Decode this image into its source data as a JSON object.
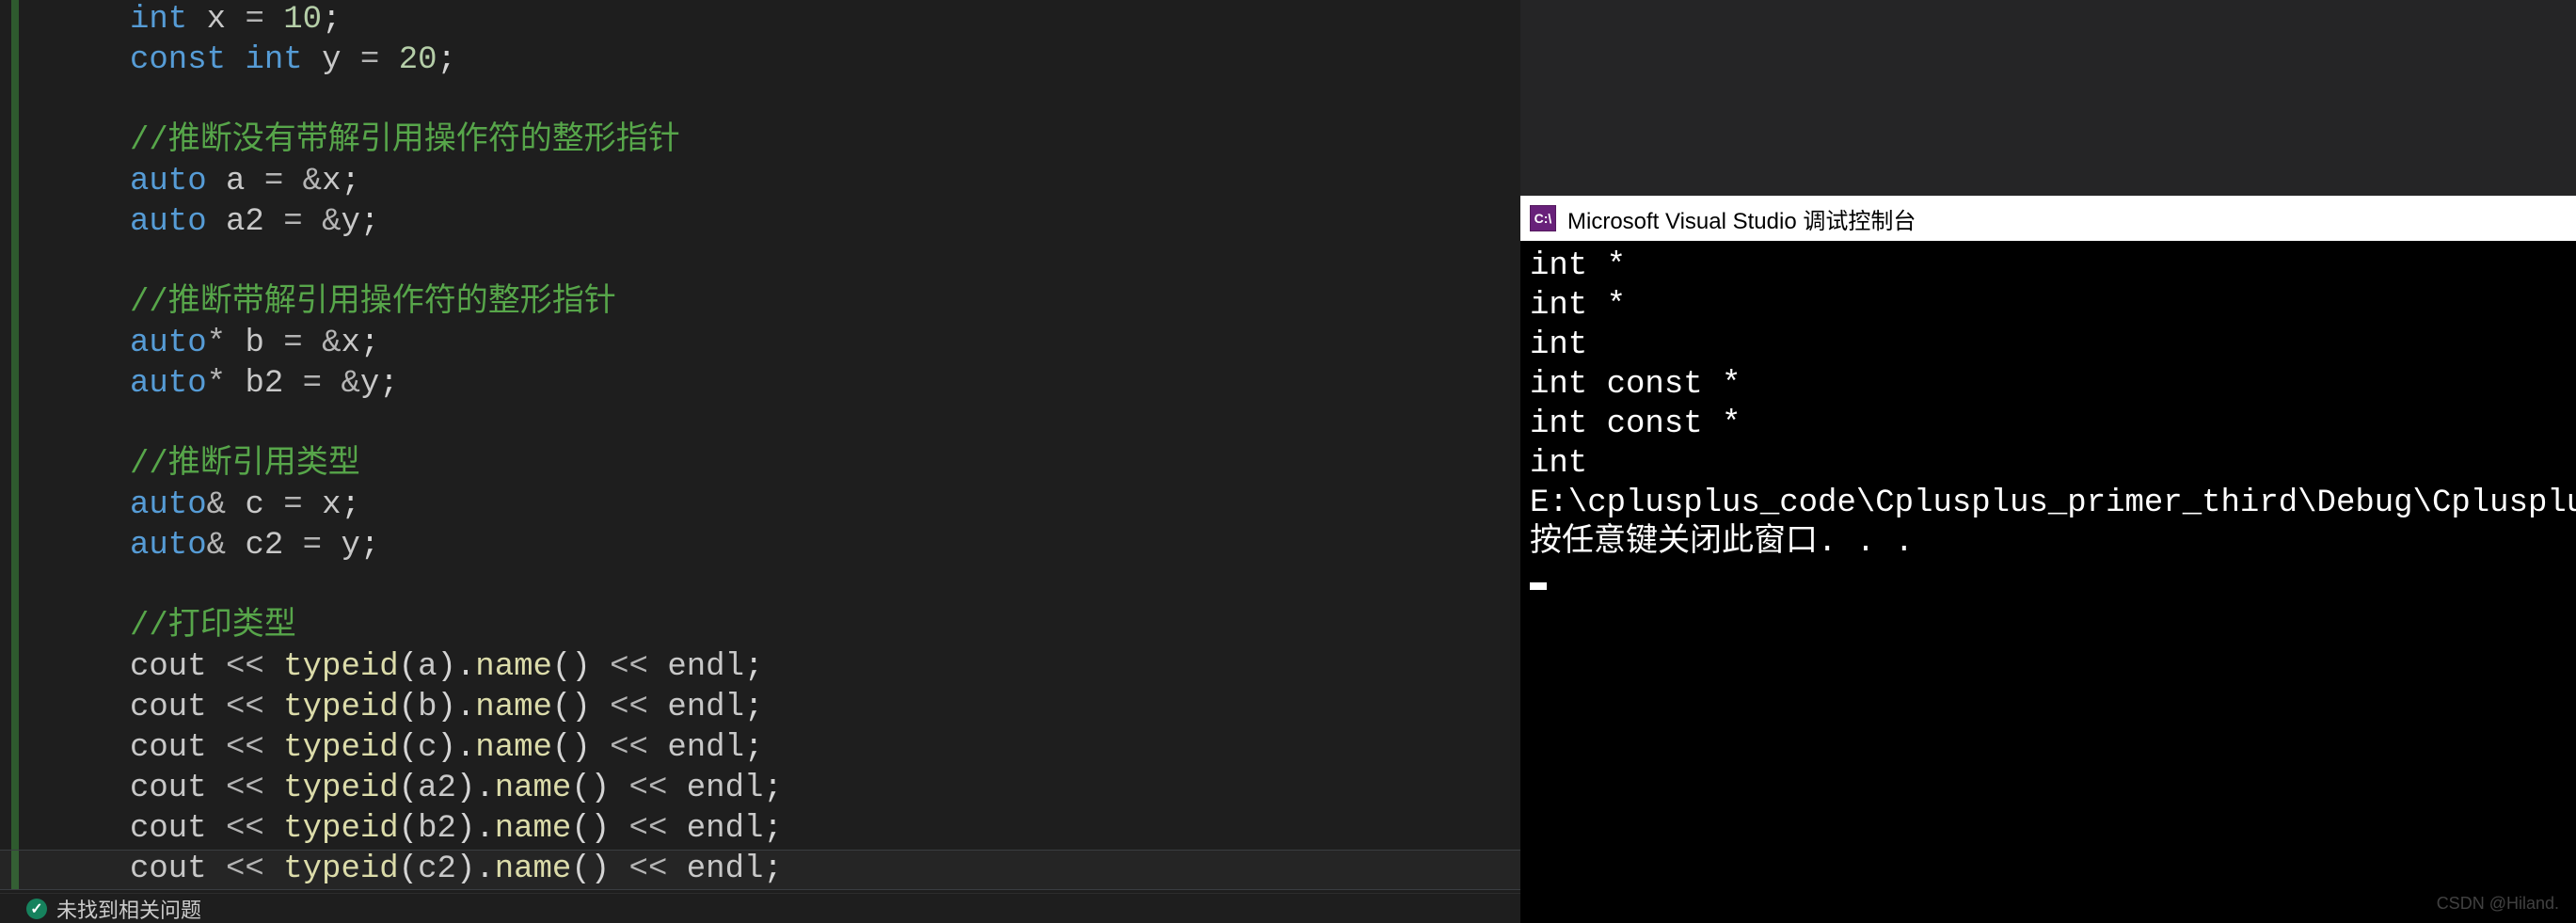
{
  "editor": {
    "lines": [
      {
        "indent": 1,
        "tokens": [
          [
            "kw",
            "int"
          ],
          [
            "punc",
            " "
          ],
          [
            "ident",
            "x"
          ],
          [
            "punc",
            " "
          ],
          [
            "op",
            "="
          ],
          [
            "punc",
            " "
          ],
          [
            "num",
            "10"
          ],
          [
            "punc",
            ";"
          ]
        ]
      },
      {
        "indent": 1,
        "tokens": [
          [
            "kw",
            "const"
          ],
          [
            "punc",
            " "
          ],
          [
            "kw",
            "int"
          ],
          [
            "punc",
            " "
          ],
          [
            "ident",
            "y"
          ],
          [
            "punc",
            " "
          ],
          [
            "op",
            "="
          ],
          [
            "punc",
            " "
          ],
          [
            "num",
            "20"
          ],
          [
            "punc",
            ";"
          ]
        ]
      },
      {
        "indent": 1,
        "tokens": []
      },
      {
        "indent": 1,
        "tokens": [
          [
            "cmt",
            "//推断没有带解引用操作符的整形指针"
          ]
        ]
      },
      {
        "indent": 1,
        "tokens": [
          [
            "kw",
            "auto"
          ],
          [
            "punc",
            " "
          ],
          [
            "ident",
            "a"
          ],
          [
            "punc",
            " "
          ],
          [
            "op",
            "="
          ],
          [
            "punc",
            " "
          ],
          [
            "op",
            "&"
          ],
          [
            "ident",
            "x"
          ],
          [
            "punc",
            ";"
          ]
        ]
      },
      {
        "indent": 1,
        "tokens": [
          [
            "kw",
            "auto"
          ],
          [
            "punc",
            " "
          ],
          [
            "ident",
            "a2"
          ],
          [
            "punc",
            " "
          ],
          [
            "op",
            "="
          ],
          [
            "punc",
            " "
          ],
          [
            "op",
            "&"
          ],
          [
            "ident",
            "y"
          ],
          [
            "punc",
            ";"
          ]
        ]
      },
      {
        "indent": 1,
        "tokens": []
      },
      {
        "indent": 1,
        "tokens": [
          [
            "cmt",
            "//推断带解引用操作符的整形指针"
          ]
        ]
      },
      {
        "indent": 1,
        "tokens": [
          [
            "kw",
            "auto"
          ],
          [
            "op",
            "*"
          ],
          [
            "punc",
            " "
          ],
          [
            "ident",
            "b"
          ],
          [
            "punc",
            " "
          ],
          [
            "op",
            "="
          ],
          [
            "punc",
            " "
          ],
          [
            "op",
            "&"
          ],
          [
            "ident",
            "x"
          ],
          [
            "punc",
            ";"
          ]
        ]
      },
      {
        "indent": 1,
        "tokens": [
          [
            "kw",
            "auto"
          ],
          [
            "op",
            "*"
          ],
          [
            "punc",
            " "
          ],
          [
            "ident",
            "b2"
          ],
          [
            "punc",
            " "
          ],
          [
            "op",
            "="
          ],
          [
            "punc",
            " "
          ],
          [
            "op",
            "&"
          ],
          [
            "ident",
            "y"
          ],
          [
            "punc",
            ";"
          ]
        ]
      },
      {
        "indent": 1,
        "tokens": []
      },
      {
        "indent": 1,
        "tokens": [
          [
            "cmt",
            "//推断引用类型"
          ]
        ]
      },
      {
        "indent": 1,
        "tokens": [
          [
            "kw",
            "auto"
          ],
          [
            "op",
            "&"
          ],
          [
            "punc",
            " "
          ],
          [
            "ident",
            "c"
          ],
          [
            "punc",
            " "
          ],
          [
            "op",
            "="
          ],
          [
            "punc",
            " "
          ],
          [
            "ident",
            "x"
          ],
          [
            "punc",
            ";"
          ]
        ]
      },
      {
        "indent": 1,
        "tokens": [
          [
            "kw",
            "auto"
          ],
          [
            "op",
            "&"
          ],
          [
            "punc",
            " "
          ],
          [
            "ident",
            "c2"
          ],
          [
            "punc",
            " "
          ],
          [
            "op",
            "="
          ],
          [
            "punc",
            " "
          ],
          [
            "ident",
            "y"
          ],
          [
            "punc",
            ";"
          ]
        ]
      },
      {
        "indent": 1,
        "tokens": []
      },
      {
        "indent": 1,
        "tokens": [
          [
            "cmt",
            "//打印类型"
          ]
        ]
      },
      {
        "indent": 1,
        "tokens": [
          [
            "ident",
            "cout"
          ],
          [
            "punc",
            " "
          ],
          [
            "op",
            "<<"
          ],
          [
            "punc",
            " "
          ],
          [
            "func",
            "typeid"
          ],
          [
            "punc",
            "("
          ],
          [
            "ident",
            "a"
          ],
          [
            "punc",
            ")."
          ],
          [
            "call",
            "name"
          ],
          [
            "punc",
            "()"
          ],
          [
            "punc",
            " "
          ],
          [
            "op",
            "<<"
          ],
          [
            "punc",
            " "
          ],
          [
            "ident",
            "endl"
          ],
          [
            "punc",
            ";"
          ]
        ]
      },
      {
        "indent": 1,
        "tokens": [
          [
            "ident",
            "cout"
          ],
          [
            "punc",
            " "
          ],
          [
            "op",
            "<<"
          ],
          [
            "punc",
            " "
          ],
          [
            "func",
            "typeid"
          ],
          [
            "punc",
            "("
          ],
          [
            "ident",
            "b"
          ],
          [
            "punc",
            ")."
          ],
          [
            "call",
            "name"
          ],
          [
            "punc",
            "()"
          ],
          [
            "punc",
            " "
          ],
          [
            "op",
            "<<"
          ],
          [
            "punc",
            " "
          ],
          [
            "ident",
            "endl"
          ],
          [
            "punc",
            ";"
          ]
        ]
      },
      {
        "indent": 1,
        "tokens": [
          [
            "ident",
            "cout"
          ],
          [
            "punc",
            " "
          ],
          [
            "op",
            "<<"
          ],
          [
            "punc",
            " "
          ],
          [
            "func",
            "typeid"
          ],
          [
            "punc",
            "("
          ],
          [
            "ident",
            "c"
          ],
          [
            "punc",
            ")."
          ],
          [
            "call",
            "name"
          ],
          [
            "punc",
            "()"
          ],
          [
            "punc",
            " "
          ],
          [
            "op",
            "<<"
          ],
          [
            "punc",
            " "
          ],
          [
            "ident",
            "endl"
          ],
          [
            "punc",
            ";"
          ]
        ]
      },
      {
        "indent": 1,
        "tokens": [
          [
            "ident",
            "cout"
          ],
          [
            "punc",
            " "
          ],
          [
            "op",
            "<<"
          ],
          [
            "punc",
            " "
          ],
          [
            "func",
            "typeid"
          ],
          [
            "punc",
            "("
          ],
          [
            "ident",
            "a2"
          ],
          [
            "punc",
            ")."
          ],
          [
            "call",
            "name"
          ],
          [
            "punc",
            "()"
          ],
          [
            "punc",
            " "
          ],
          [
            "op",
            "<<"
          ],
          [
            "punc",
            " "
          ],
          [
            "ident",
            "endl"
          ],
          [
            "punc",
            ";"
          ]
        ]
      },
      {
        "indent": 1,
        "tokens": [
          [
            "ident",
            "cout"
          ],
          [
            "punc",
            " "
          ],
          [
            "op",
            "<<"
          ],
          [
            "punc",
            " "
          ],
          [
            "func",
            "typeid"
          ],
          [
            "punc",
            "("
          ],
          [
            "ident",
            "b2"
          ],
          [
            "punc",
            ")."
          ],
          [
            "call",
            "name"
          ],
          [
            "punc",
            "()"
          ],
          [
            "punc",
            " "
          ],
          [
            "op",
            "<<"
          ],
          [
            "punc",
            " "
          ],
          [
            "ident",
            "endl"
          ],
          [
            "punc",
            ";"
          ]
        ]
      },
      {
        "indent": 1,
        "tokens": [
          [
            "ident",
            "cout"
          ],
          [
            "punc",
            " "
          ],
          [
            "op",
            "<<"
          ],
          [
            "punc",
            " "
          ],
          [
            "func",
            "typeid"
          ],
          [
            "punc",
            "("
          ],
          [
            "ident",
            "c2"
          ],
          [
            "punc",
            ")."
          ],
          [
            "call",
            "name"
          ],
          [
            "punc",
            "()"
          ],
          [
            "punc",
            " "
          ],
          [
            "op",
            "<<"
          ],
          [
            "punc",
            " "
          ],
          [
            "ident",
            "endl"
          ],
          [
            "punc",
            ";"
          ]
        ]
      }
    ],
    "highlight_line_index": 21
  },
  "console": {
    "title_icon_text": "C:\\",
    "title": "Microsoft Visual Studio 调试控制台",
    "lines": [
      "int *",
      "int *",
      "int",
      "int const *",
      "int const *",
      "int",
      "",
      "E:\\cplusplus_code\\Cplusplus_primer_third\\Debug\\Cplusplus_",
      "按任意键关闭此窗口. . ."
    ]
  },
  "status": {
    "text": "未找到相关问题"
  },
  "watermark": "CSDN @Hiland."
}
